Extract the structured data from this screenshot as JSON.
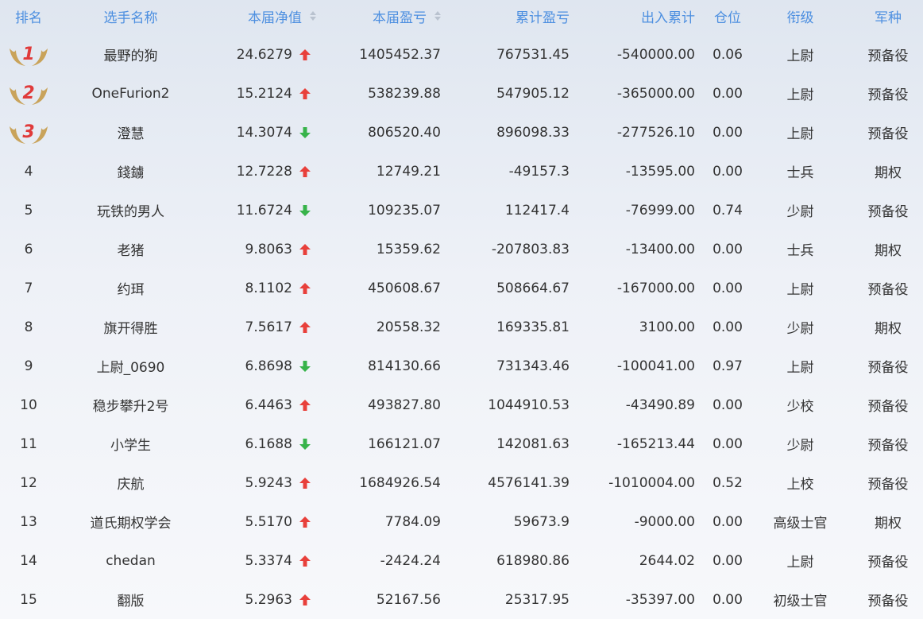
{
  "headers": {
    "rank": "排名",
    "name": "选手名称",
    "nav": "本届净值",
    "pnl": "本届盈亏",
    "cum": "累计盈亏",
    "flow": "出入累计",
    "position": "仓位",
    "title": "衔级",
    "type": "军种"
  },
  "colors": {
    "up": "#e8403b",
    "down": "#37b34a",
    "header": "#4d8fe0",
    "medal": "#c9a35a",
    "medal_number": "#e03a3a"
  },
  "rows": [
    {
      "rank": "1",
      "medal": true,
      "name": "最野的狗",
      "nav": "24.6279",
      "dir": "up",
      "pnl": "1405452.37",
      "cum": "767531.45",
      "flow": "-540000.00",
      "position": "0.06",
      "title": "上尉",
      "type": "预备役"
    },
    {
      "rank": "2",
      "medal": true,
      "name": "OneFurion2",
      "nav": "15.2124",
      "dir": "up",
      "pnl": "538239.88",
      "cum": "547905.12",
      "flow": "-365000.00",
      "position": "0.00",
      "title": "上尉",
      "type": "预备役"
    },
    {
      "rank": "3",
      "medal": true,
      "name": "澄慧",
      "nav": "14.3074",
      "dir": "down",
      "pnl": "806520.40",
      "cum": "896098.33",
      "flow": "-277526.10",
      "position": "0.00",
      "title": "上尉",
      "type": "预备役"
    },
    {
      "rank": "4",
      "medal": false,
      "name": "錢鐪",
      "nav": "12.7228",
      "dir": "up",
      "pnl": "12749.21",
      "cum": "-49157.3",
      "flow": "-13595.00",
      "position": "0.00",
      "title": "士兵",
      "type": "期权"
    },
    {
      "rank": "5",
      "medal": false,
      "name": "玩铁的男人",
      "nav": "11.6724",
      "dir": "down",
      "pnl": "109235.07",
      "cum": "112417.4",
      "flow": "-76999.00",
      "position": "0.74",
      "title": "少尉",
      "type": "预备役"
    },
    {
      "rank": "6",
      "medal": false,
      "name": "老猪",
      "nav": "9.8063",
      "dir": "up",
      "pnl": "15359.62",
      "cum": "-207803.83",
      "flow": "-13400.00",
      "position": "0.00",
      "title": "士兵",
      "type": "期权"
    },
    {
      "rank": "7",
      "medal": false,
      "name": "约珥",
      "nav": "8.1102",
      "dir": "up",
      "pnl": "450608.67",
      "cum": "508664.67",
      "flow": "-167000.00",
      "position": "0.00",
      "title": "上尉",
      "type": "预备役"
    },
    {
      "rank": "8",
      "medal": false,
      "name": "旗开得胜",
      "nav": "7.5617",
      "dir": "up",
      "pnl": "20558.32",
      "cum": "169335.81",
      "flow": "3100.00",
      "position": "0.00",
      "title": "少尉",
      "type": "期权"
    },
    {
      "rank": "9",
      "medal": false,
      "name": "上尉_0690",
      "nav": "6.8698",
      "dir": "down",
      "pnl": "814130.66",
      "cum": "731343.46",
      "flow": "-100041.00",
      "position": "0.97",
      "title": "上尉",
      "type": "预备役"
    },
    {
      "rank": "10",
      "medal": false,
      "name": "稳步攀升2号",
      "nav": "6.4463",
      "dir": "up",
      "pnl": "493827.80",
      "cum": "1044910.53",
      "flow": "-43490.89",
      "position": "0.00",
      "title": "少校",
      "type": "预备役"
    },
    {
      "rank": "11",
      "medal": false,
      "name": "小学生",
      "nav": "6.1688",
      "dir": "down",
      "pnl": "166121.07",
      "cum": "142081.63",
      "flow": "-165213.44",
      "position": "0.00",
      "title": "少尉",
      "type": "预备役"
    },
    {
      "rank": "12",
      "medal": false,
      "name": "庆航",
      "nav": "5.9243",
      "dir": "up",
      "pnl": "1684926.54",
      "cum": "4576141.39",
      "flow": "-1010004.00",
      "position": "0.52",
      "title": "上校",
      "type": "预备役"
    },
    {
      "rank": "13",
      "medal": false,
      "name": "道氏期权学会",
      "nav": "5.5170",
      "dir": "up",
      "pnl": "7784.09",
      "cum": "59673.9",
      "flow": "-9000.00",
      "position": "0.00",
      "title": "高级士官",
      "type": "期权"
    },
    {
      "rank": "14",
      "medal": false,
      "name": "chedan",
      "nav": "5.3374",
      "dir": "up",
      "pnl": "-2424.24",
      "cum": "618980.86",
      "flow": "2644.02",
      "position": "0.00",
      "title": "上尉",
      "type": "预备役"
    },
    {
      "rank": "15",
      "medal": false,
      "name": "翻版",
      "nav": "5.2963",
      "dir": "up",
      "pnl": "52167.56",
      "cum": "25317.95",
      "flow": "-35397.00",
      "position": "0.00",
      "title": "初级士官",
      "type": "预备役"
    }
  ]
}
